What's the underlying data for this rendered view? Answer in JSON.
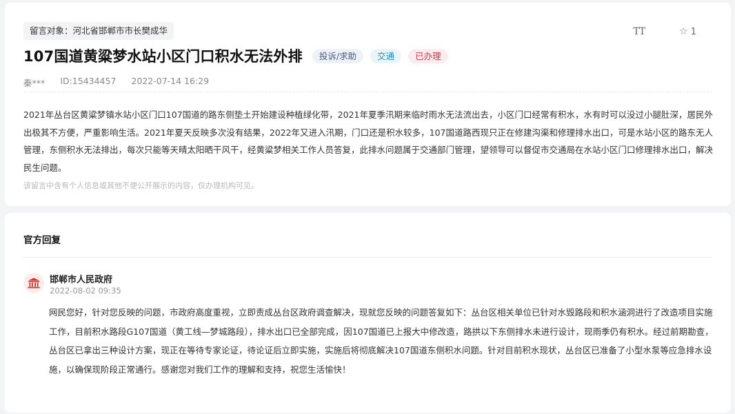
{
  "message": {
    "target_label": "留言对象：河北省邯郸市市长樊成华",
    "title": "107国道黄粱梦水站小区门口积水无法外排",
    "badges": {
      "type": "投诉/求助",
      "field": "交通",
      "status": "已办理"
    },
    "meta": {
      "author": "秦***",
      "id": "ID:15434457",
      "datetime": "2022-07-14 16:29"
    },
    "content": "2021年丛台区黄粱梦镇水站小区门口107国道的路东侧垫土开始建设种植绿化带，2021年夏季汛期来临时雨水无法流出去，小区门口经常有积水，水有时可以没过小腿肚深，居民外出极其不方便，严重影响生活。2021年夏天反映多次没有结果，2022年又进入汛期，门口还是积水较多，107国道路西现只正在修建沟渠和修理排水出口，可是水站小区的路东无人管理，东侧积水无法排出，每次只能等天晴太阳晒干风干，经黄粱梦相关工作人员答复，此排水问题属于交通部门管理，望领导可以督促市交通局在水站小区门口修理排水出口，解决民生问题。",
    "privacy_note": "该留言中含有个人信息或其他不便公开展示的内容，仅办理机构可见。"
  },
  "tools": {
    "font_label": "TT",
    "fav_count": "1",
    "fav_icon": "star-icon",
    "font_icon": "font-size-icon"
  },
  "reply": {
    "section_title": "官方回复",
    "org_name": "邯郸市人民政府",
    "org_icon": "government-building-icon",
    "date": "2022-08-02 09:35",
    "content": "网民您好，针对您反映的问题，市政府高度重视，立即责成丛台区政府调查解决，现就您反映的问题答复如下：丛台区相关单位已针对水毁路段和积水涵洞进行了改造项目实施工作，目前积水路段G107国道（黄工线—梦城路段），排水出口已全部完成，因107国道已上报大中修改造，路拱以下东侧排水未进行设计，现雨季仍有积水。经过前期勘查，丛台区已拿出三种设计方案，现正在等待专家论证，待论证后立即实施，实施后将彻底解决107国道东侧积水问题。针对目前积水现状，丛台区已准备了小型水泵等应急排水设施，以确保现阶段正常通行。感谢您对我们工作的理解和支持，祝您生活愉快！"
  },
  "colors": {
    "status_red": "#d03a48",
    "field_blue": "#2a8aad",
    "type_gray": "#4a5a80",
    "icon_red": "#c0392b"
  }
}
